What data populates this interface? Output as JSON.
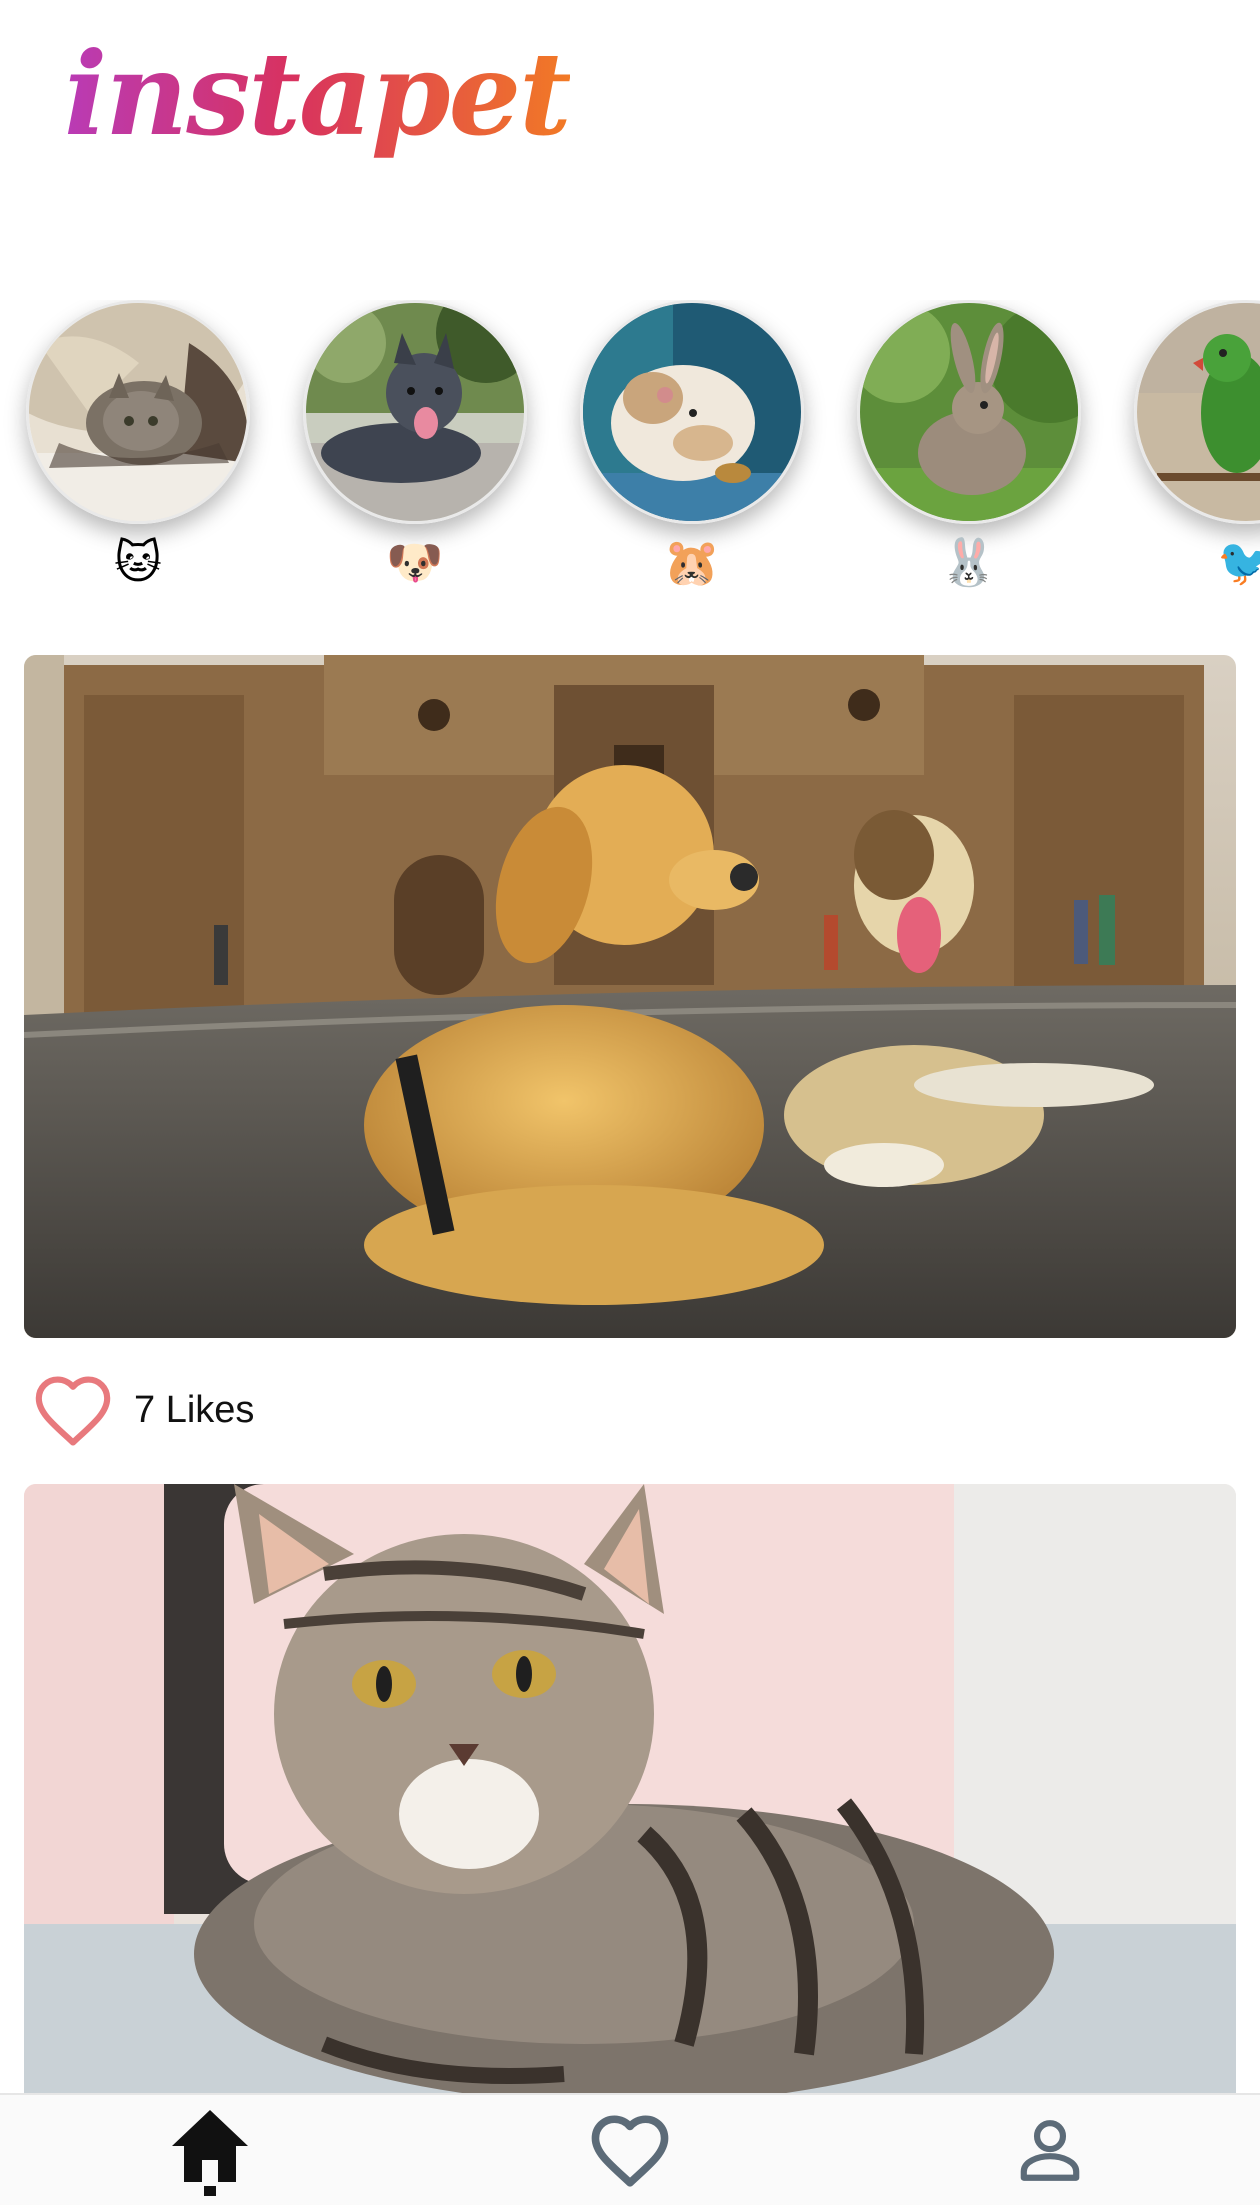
{
  "app": {
    "logo_text": "instapet"
  },
  "stories": [
    {
      "emoji": "🐱",
      "photo_subject": "cat under blanket"
    },
    {
      "emoji": "🐶",
      "photo_subject": "grey pitbull"
    },
    {
      "emoji": "🐹",
      "photo_subject": "hamster"
    },
    {
      "emoji": "🐰",
      "photo_subject": "rabbit in grass"
    },
    {
      "emoji": "🐦",
      "photo_subject": "green parrot"
    }
  ],
  "posts": [
    {
      "photo_subject": "two dogs lying in front of a cathedral",
      "likes_text": "7 Likes"
    },
    {
      "photo_subject": "tabby cat lying on sofa",
      "likes_text": ""
    }
  ],
  "colors": {
    "logo_gradient": [
      "#b93bb6",
      "#d8325f",
      "#f27a25"
    ],
    "heart_outline": "#e8797d",
    "nav_active": "#111111",
    "nav_inactive": "#5c6b78"
  },
  "bottom_nav": [
    {
      "icon": "home-icon",
      "active": true
    },
    {
      "icon": "heart-icon",
      "active": false
    },
    {
      "icon": "user-icon",
      "active": false
    }
  ]
}
